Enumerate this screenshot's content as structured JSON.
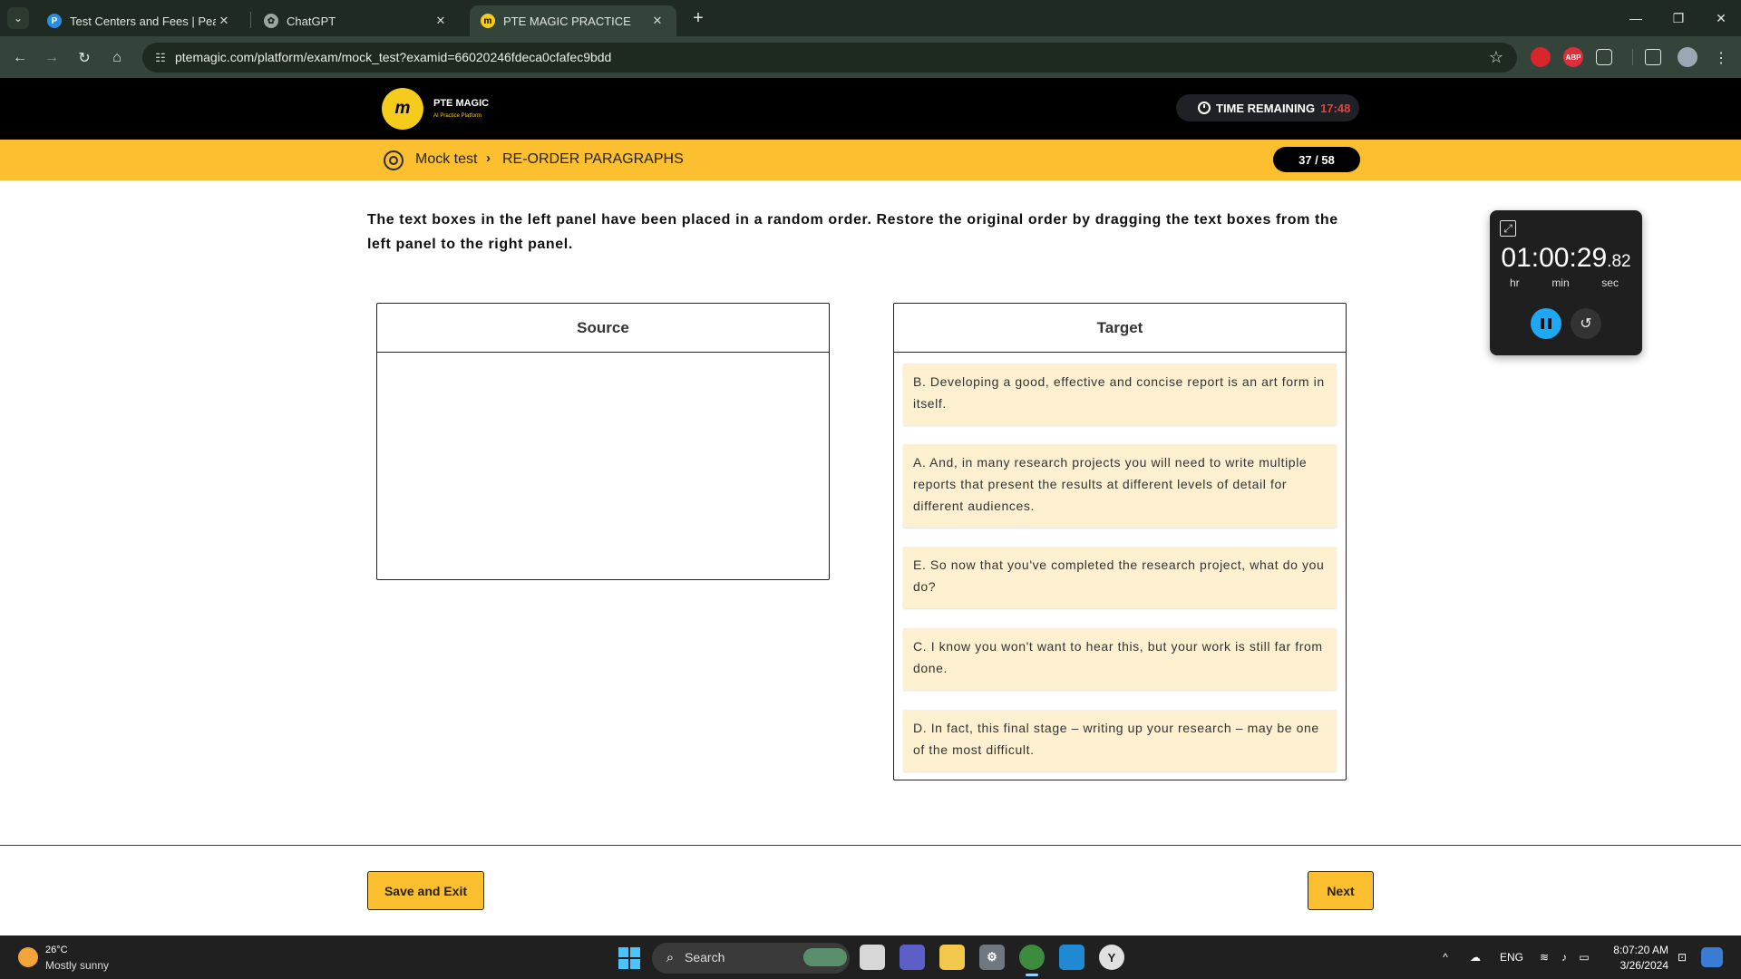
{
  "colors": {
    "accent_yellow": "#fcbf30",
    "logo_yellow": "#f5cc1b",
    "timer_red": "#e8413a",
    "card_bg": "#fdf0d1",
    "browser_dark": "#1f2a22",
    "stopwatch_blue": "#1ea7f2"
  },
  "browser": {
    "tabs": [
      {
        "title": "Test Centers and Fees | Pearson",
        "icon": "pearson-icon",
        "close": "✕"
      },
      {
        "title": "ChatGPT",
        "icon": "chatgpt-icon",
        "close": "✕"
      },
      {
        "title": "PTE MAGIC PRACTICE",
        "icon": "pte-magic-icon",
        "close": "✕"
      }
    ],
    "url": "ptemagic.com/platform/exam/mock_test?examid=66020246fdeca0cfafec9bdd",
    "extensions": [
      {
        "icon": "hand-extension-icon",
        "label": ""
      },
      {
        "icon": "adblock-plus-icon",
        "label": "ABP"
      },
      {
        "icon": "puzzle-icon",
        "label": ""
      }
    ]
  },
  "header": {
    "logo_mark": "m",
    "logo_name": "PTE MAGIC",
    "logo_tagline": "AI Practice Platform",
    "time_remaining_label": "TIME REMAINING",
    "time_remaining_value": "17:48"
  },
  "breadcrumb": {
    "root": "Mock test",
    "separator": "›",
    "current": "RE-ORDER PARAGRAPHS",
    "progress": "37 / 58"
  },
  "question": {
    "instructions": "The text boxes in the left panel have been placed in a random order. Restore the original order by dragging the text boxes from the left panel to the right panel.",
    "source_title": "Source",
    "target_title": "Target",
    "source_items": [],
    "target_items": [
      "B. Developing a good, effective and concise report is an art form in itself.",
      "A. And, in many research projects you will need to write multiple reports that present the results at different levels of detail for different audiences.",
      "E. So now that you've completed the research project, what do you do?",
      "C. I know you won't want to hear this, but your work is still far from done.",
      "D. In fact, this final stage – writing up your research – may be one of the most difficult."
    ]
  },
  "stopwatch": {
    "time_main": "01:00:29",
    "time_fraction": ".82",
    "units": [
      "hr",
      "min",
      "sec"
    ]
  },
  "footer": {
    "save_exit_label": "Save and Exit",
    "next_label": "Next"
  },
  "taskbar": {
    "weather_temp": "26°C",
    "weather_condition": "Mostly sunny",
    "search_placeholder": "Search",
    "language": "ENG",
    "time": "8:07:20 AM",
    "date": "3/26/2024"
  }
}
